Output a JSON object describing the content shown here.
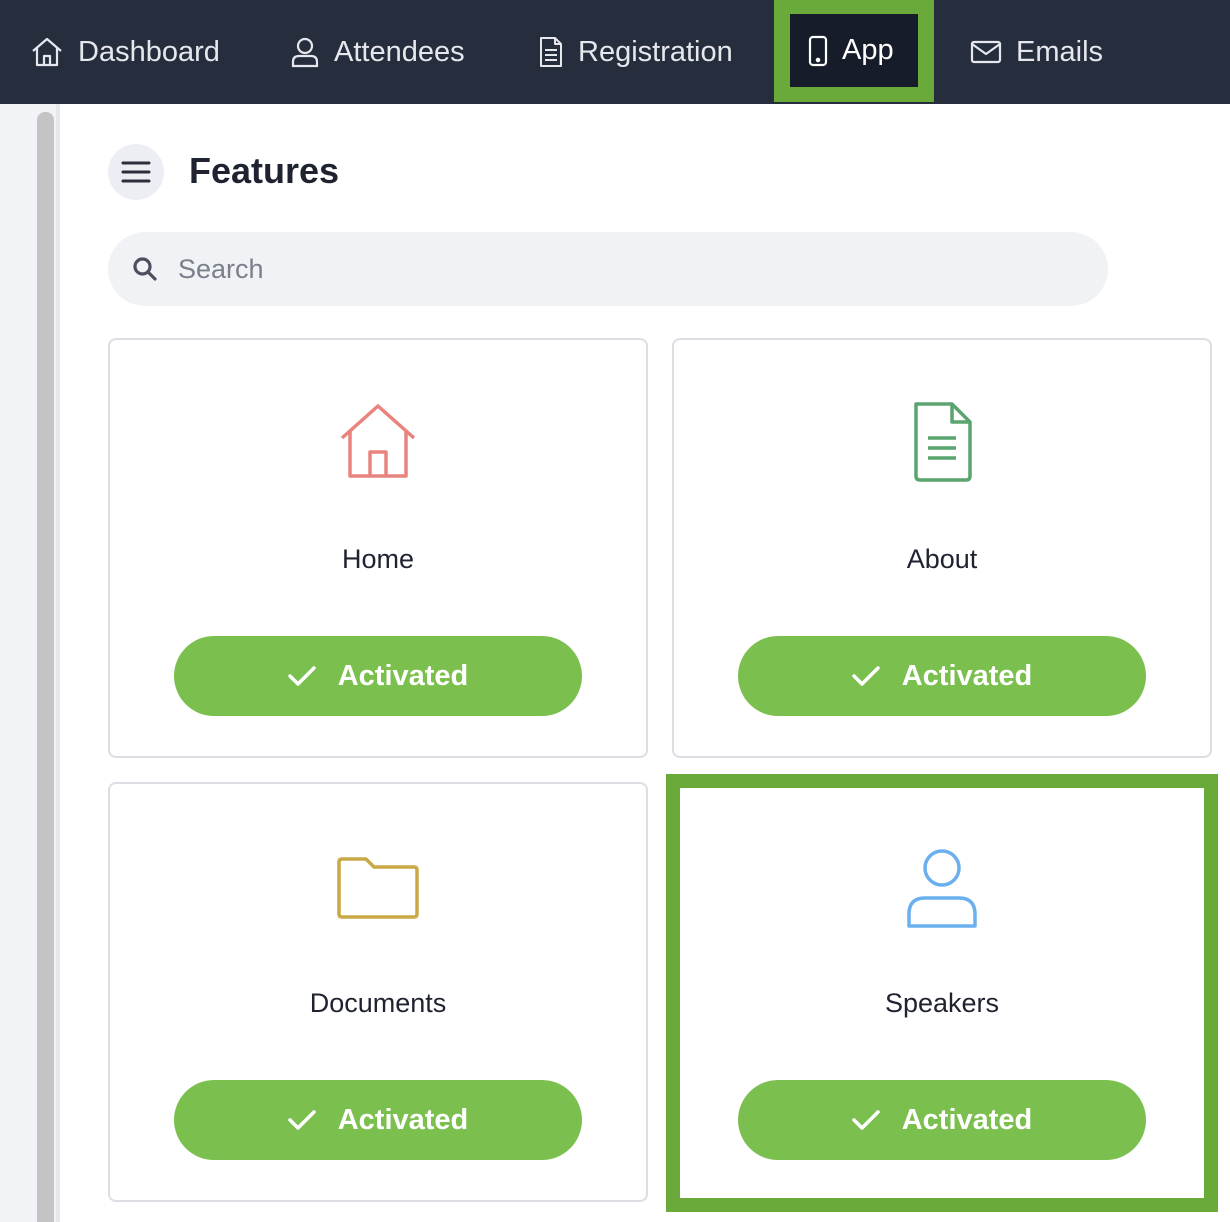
{
  "nav": {
    "items": [
      {
        "label": "Dashboard",
        "icon": "home-icon"
      },
      {
        "label": "Attendees",
        "icon": "user-icon"
      },
      {
        "label": "Registration",
        "icon": "document-icon"
      },
      {
        "label": "App",
        "icon": "phone-icon",
        "active": true
      },
      {
        "label": "Emails",
        "icon": "mail-icon"
      }
    ],
    "colors": {
      "background": "#262d3d",
      "active_background": "#171c2a",
      "highlight": "#6aaa3a"
    }
  },
  "page": {
    "title": "Features"
  },
  "search": {
    "placeholder": "Search"
  },
  "cards": [
    {
      "label": "Home",
      "icon": "home-icon",
      "icon_color": "#e8837d",
      "button": "Activated"
    },
    {
      "label": "About",
      "icon": "document-icon",
      "icon_color": "#5aa46f",
      "button": "Activated"
    },
    {
      "label": "Documents",
      "icon": "folder-icon",
      "icon_color": "#c9a845",
      "button": "Activated"
    },
    {
      "label": "Speakers",
      "icon": "user-icon",
      "icon_color": "#6ab0ee",
      "button": "Activated",
      "highlighted": true
    }
  ],
  "colors": {
    "button": "#7bc04f"
  }
}
